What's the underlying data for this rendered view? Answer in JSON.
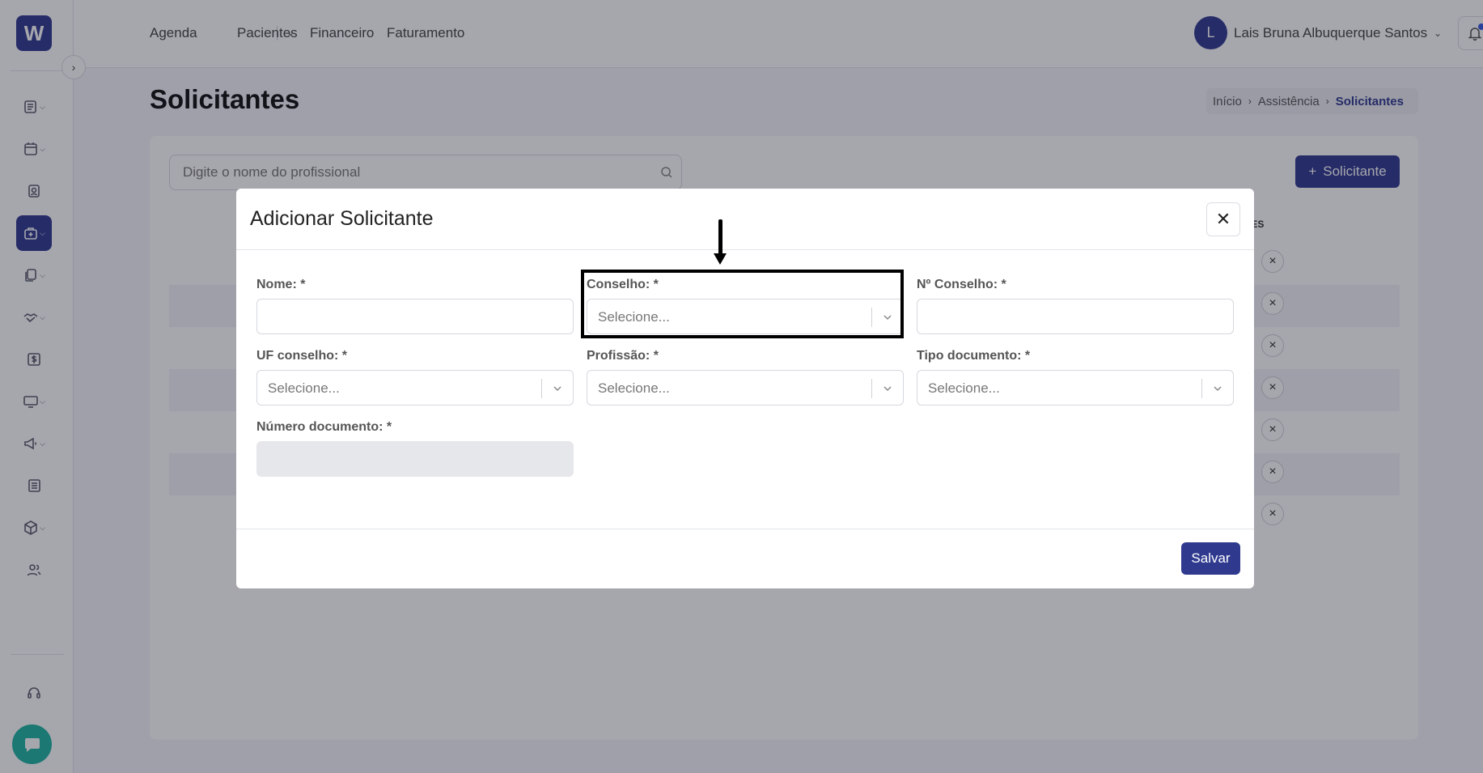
{
  "topnav": {
    "links": [
      "Agenda",
      "Pacientes",
      "Financeiro",
      "Faturamento"
    ],
    "user_initial": "L",
    "user_name": "Lais Bruna Albuquerque Santos"
  },
  "logo_text": "W",
  "page": {
    "title": "Solicitantes",
    "breadcrumb": [
      "Início",
      "Assistência",
      "Solicitantes"
    ],
    "search_placeholder": "Digite o nome do profissional",
    "add_button_label": "Solicitante",
    "column_header_partial": "ÕES"
  },
  "modal": {
    "title": "Adicionar Solicitante",
    "fields": {
      "nome": {
        "label": "Nome: *",
        "value": ""
      },
      "conselho": {
        "label": "Conselho: *",
        "placeholder": "Selecione..."
      },
      "n_conselho": {
        "label": "Nº Conselho: *",
        "value": ""
      },
      "uf_conselho": {
        "label": "UF conselho: *",
        "placeholder": "Selecione..."
      },
      "profissao": {
        "label": "Profissão: *",
        "placeholder": "Selecione..."
      },
      "tipo_documento": {
        "label": "Tipo documento: *",
        "placeholder": "Selecione..."
      },
      "numero_documento": {
        "label": "Número documento: *",
        "value": ""
      }
    },
    "save_label": "Salvar"
  },
  "colors": {
    "primary": "#2f3a8f",
    "chat_fab": "#1fb5a0",
    "highlight": "#000000"
  }
}
